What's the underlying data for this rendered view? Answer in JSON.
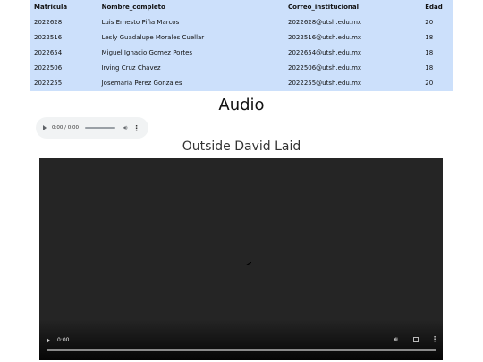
{
  "table": {
    "headers": [
      "Matricula",
      "Nombre_completo",
      "Correo_institucional",
      "Edad"
    ],
    "rows": [
      [
        "2022628",
        "Luis Ernesto Piña Marcos",
        "2022628@utsh.edu.mx",
        "20"
      ],
      [
        "2022516",
        "Lesly Guadalupe Morales Cuellar",
        "2022516@utsh.edu.mx",
        "18"
      ],
      [
        "2022654",
        "Miguel Ignacio Gomez Portes",
        "2022654@utsh.edu.mx",
        "18"
      ],
      [
        "2022506",
        "Irving Cruz Chavez",
        "2022506@utsh.edu.mx",
        "18"
      ],
      [
        "2022255",
        "Josemaria Perez Gonzales",
        "2022255@utsh.edu.mx",
        "20"
      ]
    ]
  },
  "audio": {
    "heading": "Audio",
    "time": "0:00 / 0:00",
    "play_icon": "play-icon",
    "volume_icon": "volume-icon",
    "more_icon": "more-vertical-icon"
  },
  "video": {
    "heading": "Outside David Laid",
    "time": "0:00",
    "background": "#252525",
    "play_icon": "play-icon",
    "volume_icon": "volume-icon",
    "fullscreen_icon": "fullscreen-icon",
    "more_icon": "more-vertical-icon",
    "loading_icon": "loading-spinner-icon"
  },
  "colors": {
    "table_background": "#cce0fb",
    "audio_player_background": "#f1f3f4"
  }
}
